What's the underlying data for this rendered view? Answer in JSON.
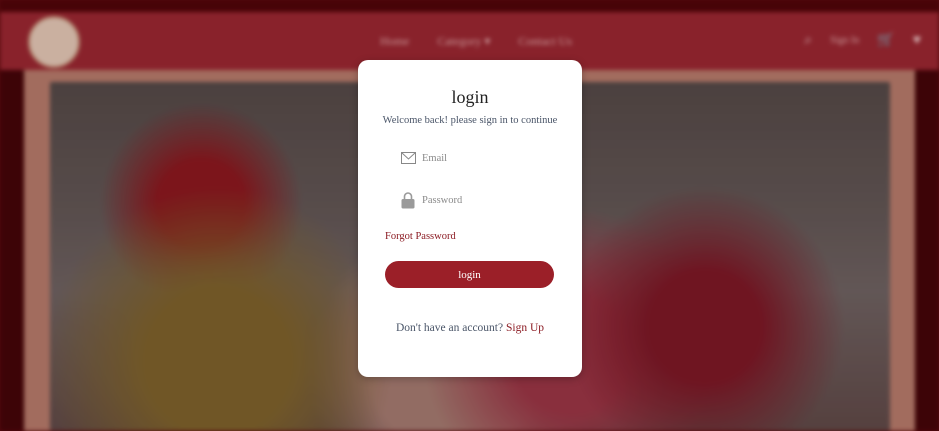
{
  "background": {
    "nav": {
      "links": [
        "Home",
        "Category",
        "Contact Us"
      ],
      "sign_in": "Sign In"
    },
    "colors": {
      "navbar": "#9a2a34",
      "accent": "#8b1a22"
    }
  },
  "modal": {
    "title": "login",
    "subtitle": "Welcome back! please sign in to continue",
    "email_placeholder": "Email",
    "password_placeholder": "Password",
    "forgot_password": "Forgot Password",
    "login_button": "login",
    "no_account_text": "Don't have an account?",
    "sign_up_link": "Sign Up"
  },
  "icons": {
    "email": "envelope-icon",
    "password": "lock-icon"
  }
}
